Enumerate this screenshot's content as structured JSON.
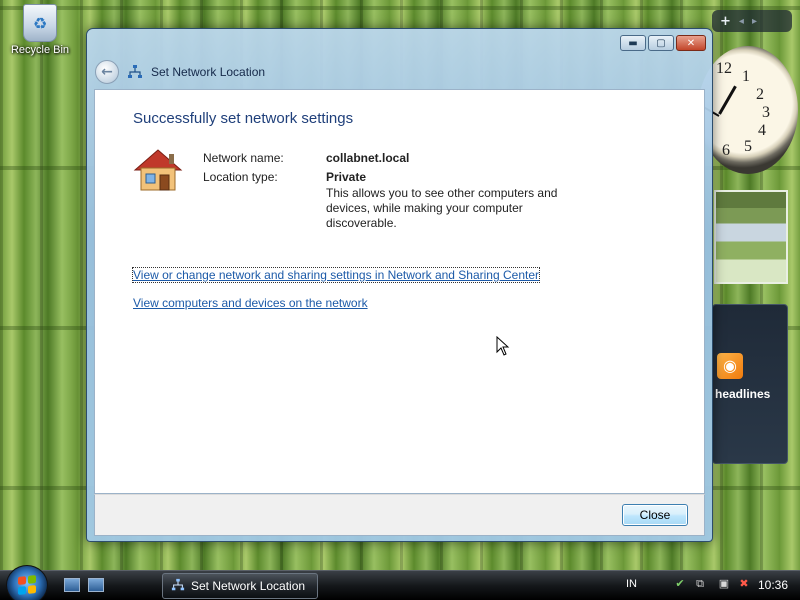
{
  "desktop": {
    "recycle_bin_label": "Recycle Bin"
  },
  "sidebar": {
    "add_symbol": "+",
    "prev_symbol": "◂",
    "next_symbol": "▸",
    "clock_numbers": [
      "12",
      "1",
      "2",
      "3",
      "4",
      "5",
      "6"
    ],
    "feed_title": "headlines"
  },
  "window": {
    "title": "Set Network Location",
    "heading": "Successfully set network settings",
    "network_name_label": "Network name:",
    "network_name_value": "collabnet.local",
    "location_type_label": "Location type:",
    "location_type_value": "Private",
    "description": "This allows you to see other computers and devices, while making your computer discoverable.",
    "link_sharing_center": "View or change network and sharing settings in Network and Sharing Center",
    "link_view_computers": "View computers and devices on the network",
    "close_button": "Close",
    "caption_minimize": "▬",
    "caption_maximize": "▢",
    "caption_close": "✕"
  },
  "taskbar": {
    "active_task": "Set Network Location",
    "language": "IN",
    "time": "10:36"
  },
  "colors": {
    "heading": "#1f3f7a",
    "link": "#1c5aa8",
    "window_frame": "#b6d3ea",
    "taskbar": "#15181b"
  }
}
